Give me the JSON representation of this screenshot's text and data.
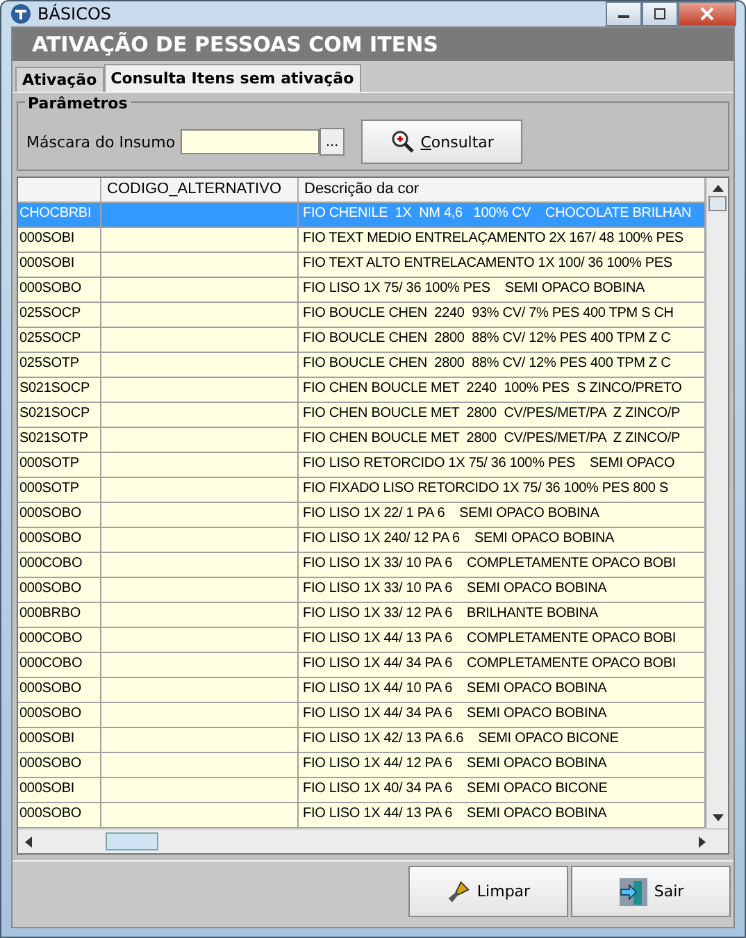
{
  "window": {
    "title": "BÁSICOS"
  },
  "header": "ATIVAÇÃO DE PESSOAS COM ITENS",
  "tabs": [
    {
      "label": "Ativação",
      "selected": false
    },
    {
      "label": "Consulta Itens sem ativação",
      "selected": true
    }
  ],
  "parameters": {
    "title": "Parâmetros",
    "mask_label": "Máscara do Insumo",
    "browse": "...",
    "search_button": "Consultar"
  },
  "table": {
    "columns": [
      "",
      "CODIGO_ALTERNATIVO",
      "Descrição da cor"
    ],
    "rows": [
      {
        "code": "CHOCBRBI",
        "description": "FIO CHENILE  1X  NM 4,6   100% CV    CHOCOLATE BRILHAN",
        "selected": true
      },
      {
        "code": "000SOBI",
        "description": "FIO TEXT MEDIO ENTRELAÇAMENTO 2X 167/ 48 100% PES",
        "selected": false
      },
      {
        "code": "000SOBI",
        "description": "FIO TEXT ALTO ENTRELACAMENTO 1X 100/ 36 100% PES",
        "selected": false
      },
      {
        "code": "000SOBO",
        "description": "FIO LISO 1X 75/ 36 100% PES    SEMI OPACO BOBINA",
        "selected": false
      },
      {
        "code": "025SOCP",
        "description": "FIO BOUCLE CHEN  2240  93% CV/ 7% PES 400 TPM S CH",
        "selected": false
      },
      {
        "code": "025SOCP",
        "description": "FIO BOUCLE CHEN  2800  88% CV/ 12% PES 400 TPM Z C",
        "selected": false
      },
      {
        "code": "025SOTP",
        "description": "FIO BOUCLE CHEN  2800  88% CV/ 12% PES 400 TPM Z C",
        "selected": false
      },
      {
        "code": "S021SOCP",
        "description": "FIO CHEN BOUCLE MET  2240  100% PES  S ZINCO/PRETO",
        "selected": false
      },
      {
        "code": "S021SOCP",
        "description": "FIO CHEN BOUCLE MET  2800  CV/PES/MET/PA  Z ZINCO/P",
        "selected": false
      },
      {
        "code": "S021SOTP",
        "description": "FIO CHEN BOUCLE MET  2800  CV/PES/MET/PA  Z ZINCO/P",
        "selected": false
      },
      {
        "code": "000SOTP",
        "description": "FIO LISO RETORCIDO 1X 75/ 36 100% PES    SEMI OPACO",
        "selected": false
      },
      {
        "code": "000SOTP",
        "description": "FIO FIXADO LISO RETORCIDO 1X 75/ 36 100% PES 800 S",
        "selected": false
      },
      {
        "code": "000SOBO",
        "description": "FIO LISO 1X 22/ 1 PA 6    SEMI OPACO BOBINA",
        "selected": false
      },
      {
        "code": "000SOBO",
        "description": "FIO LISO 1X 240/ 12 PA 6    SEMI OPACO BOBINA",
        "selected": false
      },
      {
        "code": "000COBO",
        "description": "FIO LISO 1X 33/ 10 PA 6    COMPLETAMENTE OPACO BOBI",
        "selected": false
      },
      {
        "code": "000SOBO",
        "description": "FIO LISO 1X 33/ 10 PA 6    SEMI OPACO BOBINA",
        "selected": false
      },
      {
        "code": "000BRBO",
        "description": "FIO LISO 1X 33/ 12 PA 6    BRILHANTE BOBINA",
        "selected": false
      },
      {
        "code": "000COBO",
        "description": "FIO LISO 1X 44/ 13 PA 6    COMPLETAMENTE OPACO BOBI",
        "selected": false
      },
      {
        "code": "000COBO",
        "description": "FIO LISO 1X 44/ 34 PA 6    COMPLETAMENTE OPACO BOBI",
        "selected": false
      },
      {
        "code": "000SOBO",
        "description": "FIO LISO 1X 44/ 10 PA 6    SEMI OPACO BOBINA",
        "selected": false
      },
      {
        "code": "000SOBO",
        "description": "FIO LISO 1X 44/ 34 PA 6    SEMI OPACO BOBINA",
        "selected": false
      },
      {
        "code": "000SOBI",
        "description": "FIO LISO 1X 42/ 13 PA 6.6    SEMI OPACO BICONE",
        "selected": false
      },
      {
        "code": "000SOBO",
        "description": "FIO LISO 1X 44/ 12 PA 6    SEMI OPACO BOBINA",
        "selected": false
      },
      {
        "code": "000SOBI",
        "description": "FIO LISO 1X 40/ 34 PA 6    SEMI OPACO BICONE",
        "selected": false
      },
      {
        "code": "000SOBO",
        "description": "FIO LISO 1X 44/ 13 PA 6    SEMI OPACO BOBINA",
        "selected": false
      }
    ]
  },
  "buttons": [
    {
      "kind": "clear",
      "label": "Limpar"
    },
    {
      "kind": "exit",
      "label": "Sair"
    }
  ]
}
